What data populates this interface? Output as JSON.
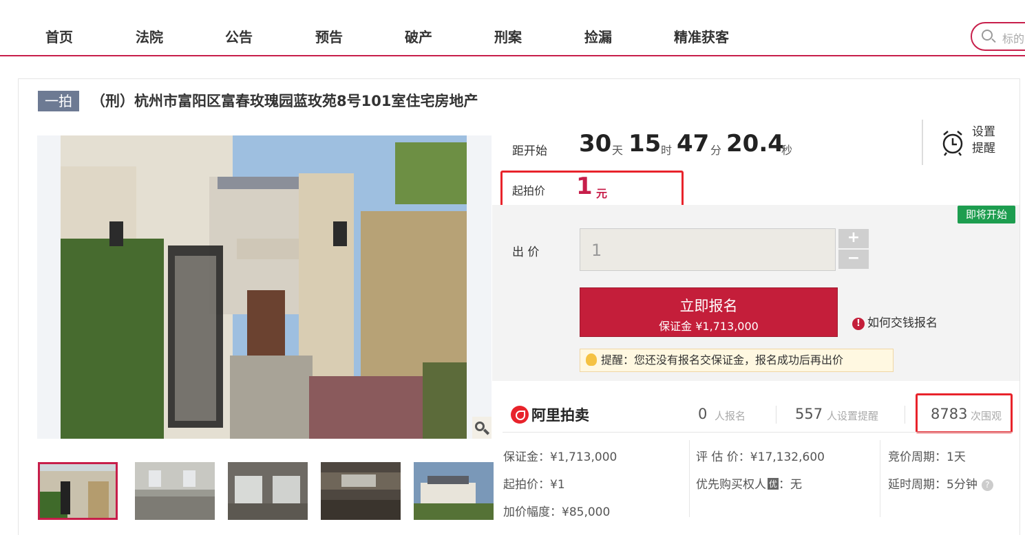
{
  "nav": {
    "items": [
      "首页",
      "法院",
      "公告",
      "预告",
      "破产",
      "刑案",
      "捡漏",
      "精准获客"
    ],
    "search_placeholder": "标的"
  },
  "auction": {
    "round_tag": "一拍",
    "title": "（刑）杭州市富阳区富春玫瑰园蓝玫苑8号101室住宅房地产"
  },
  "countdown": {
    "label": "距开始",
    "days": "30",
    "days_unit": "天",
    "hours": "15",
    "hours_unit": "时",
    "minutes": "47",
    "minutes_unit": "分",
    "seconds": "20.4",
    "seconds_unit": "秒",
    "remind_label": "设置提醒"
  },
  "start_price": {
    "label": "起拍价",
    "value": "1",
    "unit": "元"
  },
  "bid": {
    "status_badge": "即将开始",
    "label": "出 价",
    "value": "1",
    "plus": "+",
    "minus": "−",
    "signup_title": "立即报名",
    "signup_deposit": "保证金 ¥1,713,000",
    "howto": "如何交钱报名",
    "tip": "提醒：您还没有报名交保证金，报名成功后再出价"
  },
  "stats": {
    "logo_text": "阿里拍卖",
    "signups_num": "0",
    "signups_label": "人报名",
    "reminders_num": "557",
    "reminders_label": "人设置提醒",
    "views_num": "8783",
    "views_label": "次围观"
  },
  "details": {
    "deposit": "保证金：¥1,713,000",
    "start_price": "起拍价：¥1",
    "increment": "加价幅度：¥85,000",
    "appraisal": "评 估 价：¥17,132,600",
    "priority_buyer_label": "优先购买权人",
    "priority_badge": "优",
    "priority_value": "：无",
    "cycle": "竞价周期：1天",
    "delay": "延时周期：5分钟",
    "help": "?"
  },
  "colors": {
    "brand": "#c71e4a",
    "button": "#c41e3a",
    "highlight_box": "#e8232b",
    "badge_green": "#1d9d4f"
  }
}
